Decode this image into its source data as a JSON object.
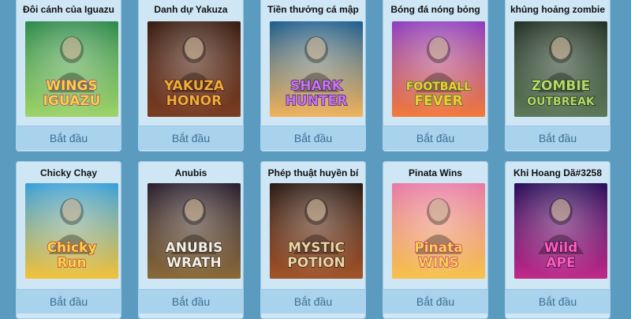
{
  "games": [
    {
      "title": "Đôi cánh của Iguazu",
      "button": "Bắt đầu",
      "logo": [
        "WINGS",
        "IGUAZU"
      ],
      "bg1": "#2e8a4c",
      "bg2": "#9fd46a",
      "logoColor": "#f6d33b",
      "logoStroke": "#a13b8e"
    },
    {
      "title": "Danh dự Yakuza",
      "button": "Bắt đầu",
      "logo": [
        "YAKUZA",
        "HONOR"
      ],
      "bg1": "#3a1d12",
      "bg2": "#7a3d22",
      "logoColor": "#e8b13a",
      "logoStroke": "#5a0c0c"
    },
    {
      "title": "Tiền thưởng cá mập",
      "button": "Bắt đầu",
      "logo": [
        "SHARK",
        "HUNTER"
      ],
      "bg1": "#1f5f8f",
      "bg2": "#f2b35c",
      "logoColor": "#c874e8",
      "logoStroke": "#3b1a66"
    },
    {
      "title": "Bóng đá nóng bỏng",
      "button": "Bắt đầu",
      "logo": [
        "FOOTBALL",
        "FEVER"
      ],
      "bg1": "#8e3fbf",
      "bg2": "#f27a3a",
      "logoColor": "#f6c93b",
      "logoStroke": "#3a7a1a"
    },
    {
      "title": "khủng hoảng zombie",
      "button": "Bắt đầu",
      "logo": [
        "ZOMBIE",
        "OUTBREAK"
      ],
      "bg1": "#233225",
      "bg2": "#5d7a59",
      "logoColor": "#b7d96a",
      "logoStroke": "#1a2a12"
    },
    {
      "title": "Chicky Chạy",
      "button": "Bắt đầu",
      "logo": [
        "Chicky",
        "Run"
      ],
      "bg1": "#3aa0d8",
      "bg2": "#f2c23a",
      "logoColor": "#f8d54a",
      "logoStroke": "#c0392b"
    },
    {
      "title": "Anubis",
      "button": "Bắt đầu",
      "logo": [
        "ANUBIS",
        "WRATH"
      ],
      "bg1": "#2a2030",
      "bg2": "#8a6a3a",
      "logoColor": "#f3f0e8",
      "logoStroke": "#3a2a1a"
    },
    {
      "title": "Phép thuật huyền bí",
      "button": "Bắt đầu",
      "logo": [
        "MYSTIC",
        "POTION"
      ],
      "bg1": "#2a1a14",
      "bg2": "#a3542a",
      "logoColor": "#e9d7a8",
      "logoStroke": "#3a1a0a"
    },
    {
      "title": "Pinata Wins",
      "button": "Bắt đầu",
      "logo": [
        "Pinata",
        "WINS"
      ],
      "bg1": "#e87aa8",
      "bg2": "#f6c24a",
      "logoColor": "#f7d24b",
      "logoStroke": "#c0307a"
    },
    {
      "title": "Khỉ Hoang Dã#3258",
      "button": "Bắt đầu",
      "logo": [
        "Wild",
        "APE"
      ],
      "bg1": "#2a0f5a",
      "bg2": "#c02a8a",
      "logoColor": "#ff5fb3",
      "logoStroke": "#3a0a5a"
    }
  ]
}
